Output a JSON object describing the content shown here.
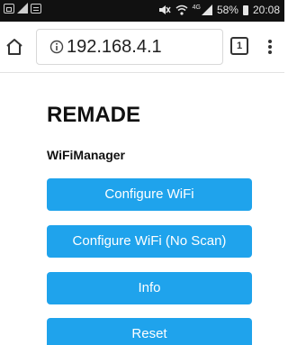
{
  "status_bar": {
    "battery": "58%",
    "time": "20:08",
    "network": "4G",
    "icons": [
      "screenshot-icon",
      "signal-icon",
      "message-icon",
      "mute-icon",
      "wifi-icon",
      "cell-signal-icon",
      "battery-icon"
    ]
  },
  "browser": {
    "url": "192.168.4.1",
    "tab_count": "1",
    "icons": [
      "home-icon",
      "info-icon",
      "tabs-icon",
      "more-vert-icon"
    ]
  },
  "page": {
    "title": "REMADE",
    "subtitle": "WiFiManager",
    "buttons": [
      {
        "label": "Configure WiFi"
      },
      {
        "label": "Configure WiFi (No Scan)"
      },
      {
        "label": "Info"
      },
      {
        "label": "Reset"
      }
    ]
  },
  "colors": {
    "button_bg": "#1fa3ec",
    "button_text": "#ffffff",
    "status_bar_bg": "#111111"
  }
}
